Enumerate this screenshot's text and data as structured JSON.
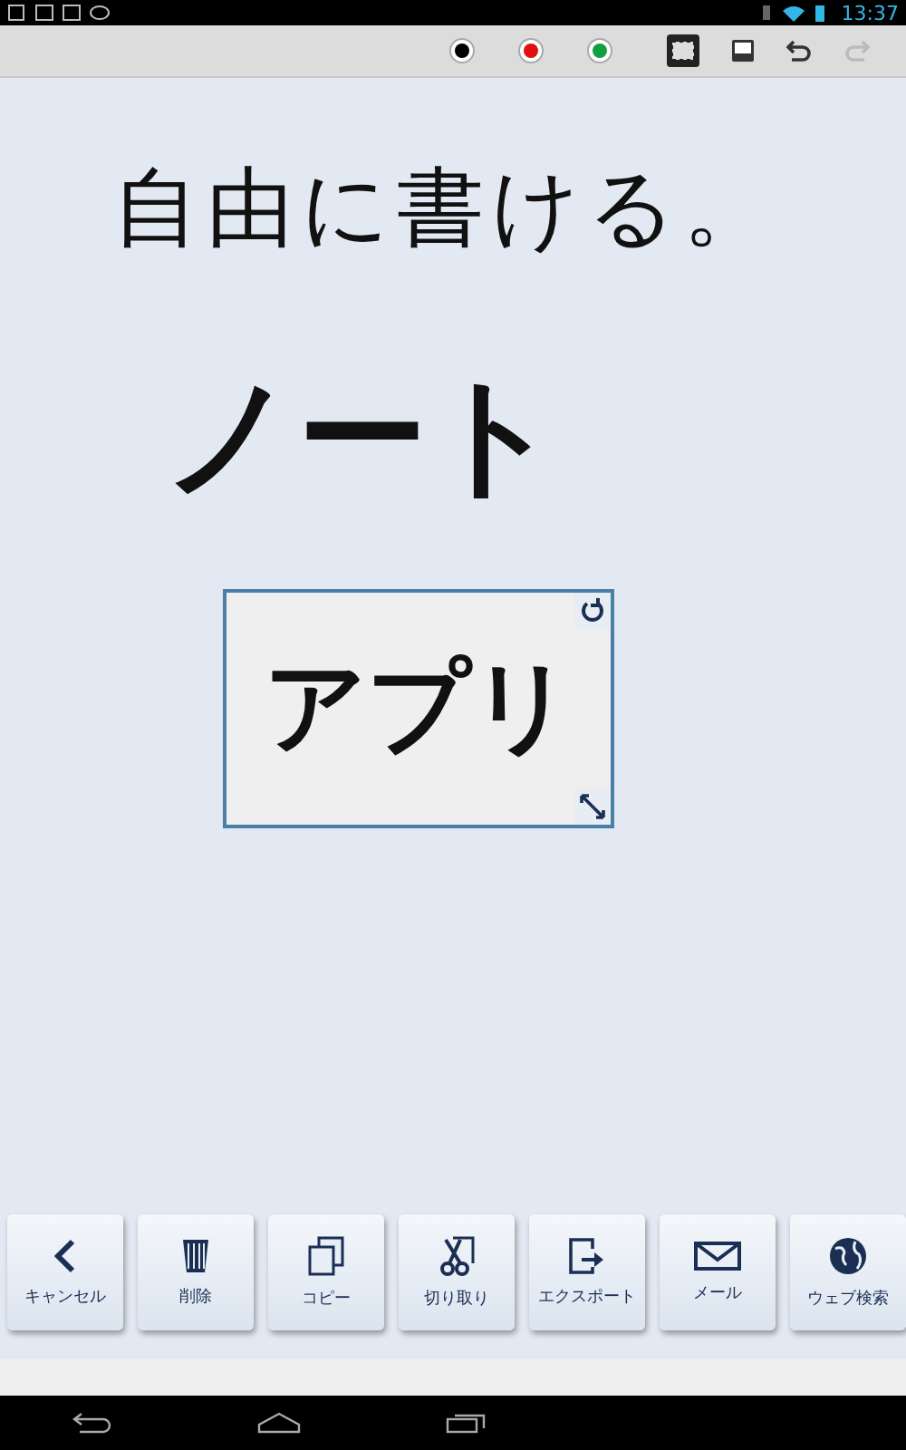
{
  "status_bar": {
    "time": "13:37"
  },
  "toolbar": {
    "pens": [
      {
        "color": "#000000",
        "selected": false
      },
      {
        "color": "#e01010",
        "selected": false
      },
      {
        "color": "#10a040",
        "selected": false
      }
    ]
  },
  "canvas": {
    "handwriting": [
      {
        "text": "自由に書ける。"
      },
      {
        "text": "ノート"
      }
    ],
    "selection": {
      "text": "アプリ"
    }
  },
  "actions": [
    {
      "kind": "back",
      "label": "キャンセル"
    },
    {
      "kind": "trash",
      "label": "削除"
    },
    {
      "kind": "copy",
      "label": "コピー"
    },
    {
      "kind": "scissors",
      "label": "切り取り"
    },
    {
      "kind": "export",
      "label": "エクスポート"
    },
    {
      "kind": "mail",
      "label": "メール"
    },
    {
      "kind": "globe",
      "label": "ウェブ検索"
    }
  ]
}
